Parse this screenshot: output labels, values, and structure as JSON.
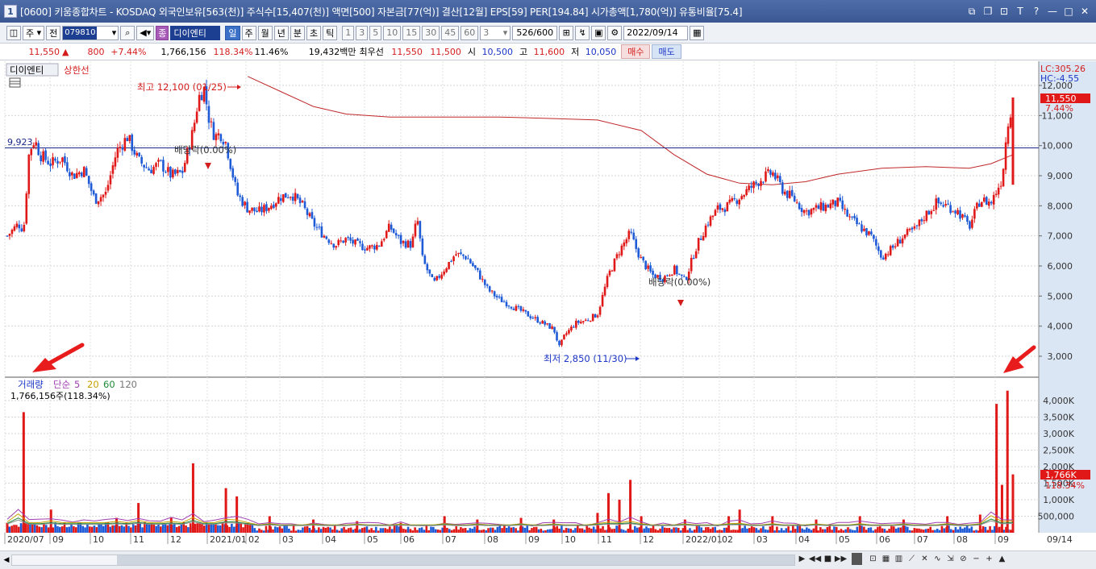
{
  "window": {
    "icon_label": "1",
    "title": "[0600] 키움종합차트 - KOSDAQ 외국인보유[563(천)] 주식수[15,407(천)] 액면[500] 자본금[77(억)] 결산[12월] EPS[59] PER[194.84] 시가총액[1,780(억)] 유통비율[75.4]"
  },
  "toolbar": {
    "period_select": "주",
    "prev_button": "전",
    "stock_code": "079810",
    "stock_badge": "종",
    "stock_name": "디이엔티",
    "period_tabs": [
      "일",
      "주",
      "월",
      "년",
      "분",
      "초",
      "틱"
    ],
    "active_tab_index": 0,
    "minute_options": [
      "1",
      "3",
      "5",
      "10",
      "15",
      "30",
      "45",
      "60"
    ],
    "interval_value": "3",
    "count_display": "526",
    "count_max": "/600",
    "date_value": "2022/09/14"
  },
  "quote": {
    "price": "11,550",
    "change": "800",
    "change_pct": "+7.44%",
    "volume": "1,766,156",
    "volume_ratio": "118.34%",
    "turnover_pct": "11.46%",
    "trade_value": "19,432백만",
    "best_ask_label": "최우선",
    "best_ask": "11,550",
    "best_bid": "11,500",
    "open_label": "시",
    "open": "10,500",
    "high_label": "고",
    "high": "11,600",
    "low_label": "저",
    "low": "10,050",
    "buy_button": "매수",
    "sell_button": "매도"
  },
  "chart_labels": {
    "stock_label": "디이엔티",
    "limit_label": "상한선",
    "lc_label": "LC:305.26",
    "hc_label": "HC:-4.55",
    "current_price_tag": "11,550",
    "current_pct_tag": "7.44%",
    "max_annotation": "최고 12,100 (01/25)",
    "min_annotation": "최저 2,850 (11/30)",
    "dividend_1": "배당락(0.00%)",
    "dividend_2": "배당락(0.00%)",
    "level_line_label": "9,923",
    "volume_title": "거래량",
    "ma_label": "단순",
    "ma_periods": [
      "5",
      "20",
      "60",
      "120"
    ],
    "volume_value": "1,766,156주(118.34%)",
    "volume_tag": "1,766K",
    "volume_pct_tag": "118.34%"
  },
  "chart_data": [
    {
      "type": "candlestick",
      "series_name": "디이엔티",
      "y_axis_ticks": [
        "12,000",
        "11,000",
        "10,000",
        "9,000",
        "8,000",
        "7,000",
        "6,000",
        "5,000",
        "4,000",
        "3,000"
      ],
      "ylim": [
        2500,
        12700
      ],
      "x_axis_ticks": [
        "2020/07",
        "09",
        "10",
        "11",
        "12",
        "2021/01",
        "02",
        "03",
        "04",
        "05",
        "06",
        "07",
        "08",
        "09",
        "10",
        "11",
        "12",
        "2022/01",
        "02",
        "03",
        "04",
        "05",
        "06",
        "07",
        "08",
        "09",
        "09/14"
      ],
      "max": {
        "value": 12100,
        "date": "01/25"
      },
      "min": {
        "value": 2850,
        "date": "11/30"
      },
      "last_close": 11550,
      "horizontal_line": 9923,
      "price_path": [
        [
          0,
          7000
        ],
        [
          2,
          7400
        ],
        [
          3,
          7200
        ],
        [
          4,
          9800
        ],
        [
          5,
          10200
        ],
        [
          6,
          9700
        ],
        [
          8,
          9400
        ],
        [
          10,
          9600
        ],
        [
          12,
          9000
        ],
        [
          14,
          9200
        ],
        [
          16,
          8200
        ],
        [
          18,
          8400
        ],
        [
          20,
          9800
        ],
        [
          22,
          10300
        ],
        [
          24,
          9500
        ],
        [
          26,
          9200
        ],
        [
          28,
          9400
        ],
        [
          30,
          9000
        ],
        [
          32,
          9100
        ],
        [
          34,
          10500
        ],
        [
          35,
          11600
        ],
        [
          36,
          11900
        ],
        [
          37,
          10800
        ],
        [
          38,
          10300
        ],
        [
          39,
          10400
        ],
        [
          40,
          10100
        ],
        [
          42,
          8400
        ],
        [
          44,
          7900
        ],
        [
          46,
          7800
        ],
        [
          48,
          8000
        ],
        [
          50,
          8300
        ],
        [
          52,
          8400
        ],
        [
          54,
          8000
        ],
        [
          56,
          7400
        ],
        [
          58,
          7000
        ],
        [
          60,
          6700
        ],
        [
          62,
          6900
        ],
        [
          64,
          6700
        ],
        [
          66,
          6600
        ],
        [
          68,
          6700
        ],
        [
          70,
          7300
        ],
        [
          72,
          6800
        ],
        [
          74,
          6700
        ],
        [
          75,
          7600
        ],
        [
          76,
          6200
        ],
        [
          78,
          5400
        ],
        [
          80,
          5900
        ],
        [
          82,
          6400
        ],
        [
          84,
          6300
        ],
        [
          86,
          5800
        ],
        [
          88,
          5200
        ],
        [
          90,
          4900
        ],
        [
          92,
          4700
        ],
        [
          94,
          4500
        ],
        [
          96,
          4300
        ],
        [
          98,
          4100
        ],
        [
          100,
          3900
        ],
        [
          101,
          3300
        ],
        [
          102,
          3700
        ],
        [
          104,
          4100
        ],
        [
          106,
          4200
        ],
        [
          108,
          4400
        ],
        [
          110,
          5700
        ],
        [
          112,
          6500
        ],
        [
          114,
          7100
        ],
        [
          115,
          6600
        ],
        [
          116,
          6200
        ],
        [
          118,
          5700
        ],
        [
          120,
          5600
        ],
        [
          122,
          5900
        ],
        [
          124,
          5500
        ],
        [
          126,
          6600
        ],
        [
          128,
          7400
        ],
        [
          130,
          7900
        ],
        [
          132,
          8000
        ],
        [
          134,
          8300
        ],
        [
          136,
          8600
        ],
        [
          138,
          8900
        ],
        [
          140,
          9100
        ],
        [
          142,
          8500
        ],
        [
          144,
          8200
        ],
        [
          146,
          7800
        ],
        [
          148,
          7900
        ],
        [
          150,
          8000
        ],
        [
          152,
          8100
        ],
        [
          154,
          7600
        ],
        [
          156,
          7300
        ],
        [
          158,
          7000
        ],
        [
          160,
          6300
        ],
        [
          162,
          6600
        ],
        [
          164,
          7000
        ],
        [
          166,
          7200
        ],
        [
          168,
          7700
        ],
        [
          170,
          8100
        ],
        [
          172,
          8000
        ],
        [
          174,
          7800
        ],
        [
          176,
          7300
        ],
        [
          178,
          8200
        ],
        [
          180,
          8100
        ],
        [
          182,
          8900
        ],
        [
          183,
          10700
        ],
        [
          184,
          11550
        ]
      ],
      "ma_path": [
        [
          44,
          12300
        ],
        [
          50,
          11800
        ],
        [
          56,
          11300
        ],
        [
          62,
          11050
        ],
        [
          70,
          10950
        ],
        [
          80,
          10950
        ],
        [
          90,
          10950
        ],
        [
          100,
          10900
        ],
        [
          108,
          10850
        ],
        [
          116,
          10500
        ],
        [
          122,
          9700
        ],
        [
          128,
          9050
        ],
        [
          134,
          8750
        ],
        [
          140,
          8700
        ],
        [
          146,
          8800
        ],
        [
          152,
          9050
        ],
        [
          160,
          9250
        ],
        [
          168,
          9300
        ],
        [
          176,
          9250
        ],
        [
          180,
          9400
        ],
        [
          184,
          9700
        ]
      ]
    },
    {
      "type": "bar",
      "series_name": "거래량",
      "y_axis_ticks": [
        "4,000K",
        "3,500K",
        "3,000K",
        "2,500K",
        "2,000K",
        "1,500K",
        "1,000K",
        "500,000"
      ],
      "ylim": [
        0,
        4500
      ],
      "last_volume_k": 1766,
      "spikes": [
        [
          0,
          300
        ],
        [
          3,
          3650
        ],
        [
          8,
          700
        ],
        [
          20,
          450
        ],
        [
          24,
          900
        ],
        [
          30,
          450
        ],
        [
          34,
          2100
        ],
        [
          40,
          1350
        ],
        [
          42,
          1100
        ],
        [
          48,
          500
        ],
        [
          56,
          400
        ],
        [
          64,
          350
        ],
        [
          72,
          300
        ],
        [
          80,
          500
        ],
        [
          86,
          400
        ],
        [
          94,
          450
        ],
        [
          100,
          400
        ],
        [
          108,
          600
        ],
        [
          110,
          1200
        ],
        [
          112,
          1000
        ],
        [
          114,
          1600
        ],
        [
          116,
          500
        ],
        [
          124,
          400
        ],
        [
          132,
          500
        ],
        [
          134,
          700
        ],
        [
          140,
          500
        ],
        [
          148,
          400
        ],
        [
          156,
          500
        ],
        [
          164,
          400
        ],
        [
          172,
          500
        ],
        [
          178,
          550
        ],
        [
          181,
          3900
        ],
        [
          182,
          1450
        ],
        [
          183,
          4300
        ],
        [
          184,
          1766
        ]
      ]
    }
  ]
}
